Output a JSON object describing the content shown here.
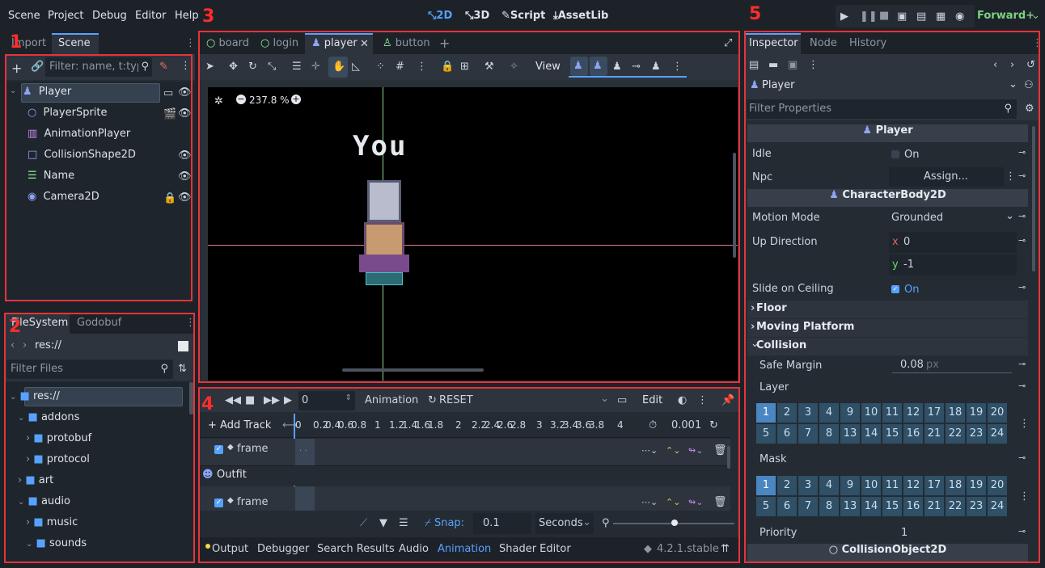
{
  "menu": {
    "scene": "Scene",
    "project": "Project",
    "debug": "Debug",
    "editor": "Editor",
    "help": "Help"
  },
  "modes": {
    "2d": "2D",
    "3d": "3D",
    "script": "Script",
    "assetlib": "AssetLib"
  },
  "renderer": "Forward+",
  "labels": {
    "n1": "1",
    "n2": "2",
    "n3": "3",
    "n4": "4",
    "n5": "5"
  },
  "scene_panel": {
    "tab_import": "Import",
    "tab_scene": "Scene",
    "filter_placeholder": "Filter: name, t:typ",
    "nodes": [
      {
        "name": "Player",
        "color": "#8da5f3"
      },
      {
        "name": "PlayerSprite",
        "color": "#8da5f3"
      },
      {
        "name": "AnimationPlayer",
        "color": "#c38ef1"
      },
      {
        "name": "CollisionShape2D",
        "color": "#8da5f3"
      },
      {
        "name": "Name",
        "color": "#8eef97"
      },
      {
        "name": "Camera2D",
        "color": "#8da5f3"
      }
    ]
  },
  "filesystem": {
    "tab_fs": "FileSystem",
    "tab_godobuf": "Godobuf",
    "path": "res://",
    "filter_placeholder": "Filter Files",
    "items": [
      "res://",
      "addons",
      "protobuf",
      "protocol",
      "art",
      "audio",
      "music",
      "sounds"
    ]
  },
  "scene_tabs": [
    "board",
    "login",
    "player",
    "button"
  ],
  "viewport": {
    "zoom": "237.8 %",
    "view": "View",
    "sprite_text": "You"
  },
  "animation": {
    "frame_value": "0",
    "anim_label": "Animation",
    "anim_name": "RESET",
    "edit": "Edit",
    "add_track": "Add Track",
    "ticks": [
      "0",
      "0.2",
      "0.4",
      "0.6",
      "0.8",
      "1",
      "1.2",
      "1.4",
      "1.6",
      "1.8",
      "2",
      "2.2",
      "2.4",
      "2.6",
      "2.8",
      "3",
      "3.2",
      "3.4",
      "3.6",
      "3.8",
      "4"
    ],
    "step": "0.001",
    "track1": "frame",
    "group": "Outfit",
    "track2": "frame",
    "snap_label": "Snap:",
    "snap_value": "0.1",
    "snap_unit": "Seconds"
  },
  "bottom_tabs": {
    "output": "Output",
    "debugger": "Debugger",
    "search": "Search Results",
    "audio": "Audio",
    "animation": "Animation",
    "shader": "Shader Editor",
    "version": "4.2.1.stable"
  },
  "inspector": {
    "tab_inspector": "Inspector",
    "tab_node": "Node",
    "tab_history": "History",
    "object": "Player",
    "filter_placeholder": "Filter Properties",
    "sec_player": "Player",
    "idle": "Idle",
    "idle_value": "On",
    "npc": "Npc",
    "npc_value": "Assign...",
    "sec_body": "CharacterBody2D",
    "motion_mode": "Motion Mode",
    "motion_value": "Grounded",
    "up_direction": "Up Direction",
    "up_x_label": "x",
    "up_x": "0",
    "up_y_label": "y",
    "up_y": "-1",
    "slide": "Slide on Ceiling",
    "slide_value": "On",
    "floor": "Floor",
    "moving": "Moving Platform",
    "collision": "Collision",
    "safe_margin": "Safe Margin",
    "safe_value": "0.08",
    "safe_unit": "px",
    "layer": "Layer",
    "mask": "Mask",
    "priority": "Priority",
    "priority_value": "1",
    "sec_collobj": "CollisionObject2D",
    "layer_rows": [
      [
        "1",
        "2",
        "3",
        "4"
      ],
      [
        "9",
        "10",
        "11",
        "12"
      ],
      [
        "17",
        "18",
        "19",
        "20"
      ]
    ],
    "layer_rows2": [
      [
        "5",
        "6",
        "7",
        "8"
      ],
      [
        "13",
        "14",
        "15",
        "16"
      ],
      [
        "21",
        "22",
        "23",
        "24"
      ]
    ]
  }
}
